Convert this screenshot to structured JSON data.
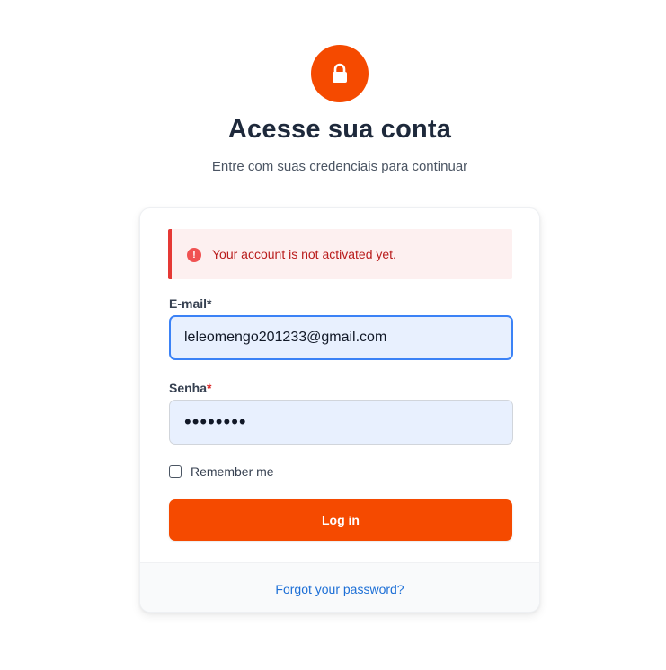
{
  "header": {
    "icon": "lock-icon",
    "title": "Acesse sua conta",
    "subtitle": "Entre com suas credenciais para continuar"
  },
  "alert": {
    "icon": "exclamation-circle-icon",
    "message": "Your account is not activated yet."
  },
  "form": {
    "email": {
      "label": "E-mail",
      "required_mark": "*",
      "value": "leleomengo201233@gmail.com"
    },
    "password": {
      "label": "Senha",
      "required_mark": "*",
      "value": "••••••••"
    },
    "remember_label": "Remember me",
    "remember_checked": false,
    "submit_label": "Log in"
  },
  "footer": {
    "forgot_link": "Forgot your password?"
  },
  "colors": {
    "accent": "#f54a00",
    "alert_border": "#e53935",
    "alert_text": "#b91c1c",
    "link": "#1d6fd6",
    "input_bg": "#e8f0fe",
    "focus_ring": "#3b82f6"
  }
}
